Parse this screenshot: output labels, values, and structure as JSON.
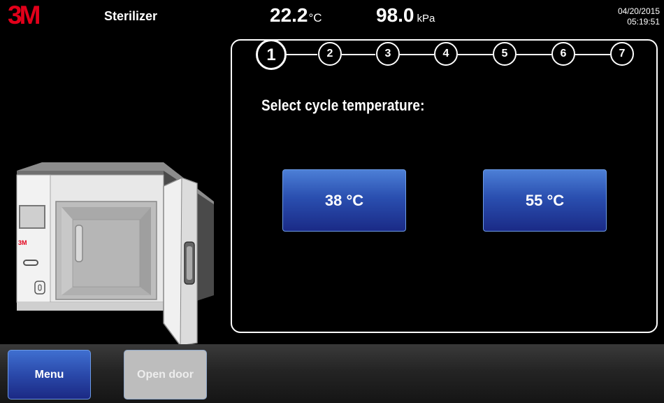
{
  "header": {
    "logo": "3M",
    "title": "Sterilizer",
    "temperature_value": "22.2",
    "temperature_unit": "°C",
    "pressure_value": "98.0",
    "pressure_unit": "kPa",
    "date": "04/20/2015",
    "time": "05:19:51"
  },
  "machine": {
    "badge": "3M"
  },
  "wizard": {
    "steps": [
      "1",
      "2",
      "3",
      "4",
      "5",
      "6",
      "7"
    ],
    "active_step": "1",
    "prompt": "Select cycle temperature:",
    "options": [
      "38 °C",
      "55 °C"
    ]
  },
  "footer": {
    "menu_label": "Menu",
    "open_door_label": "Open door"
  },
  "colors": {
    "brand_red": "#e2001a",
    "button_blue": "#2a4fb0",
    "disabled_gray": "#bdbdbd"
  }
}
